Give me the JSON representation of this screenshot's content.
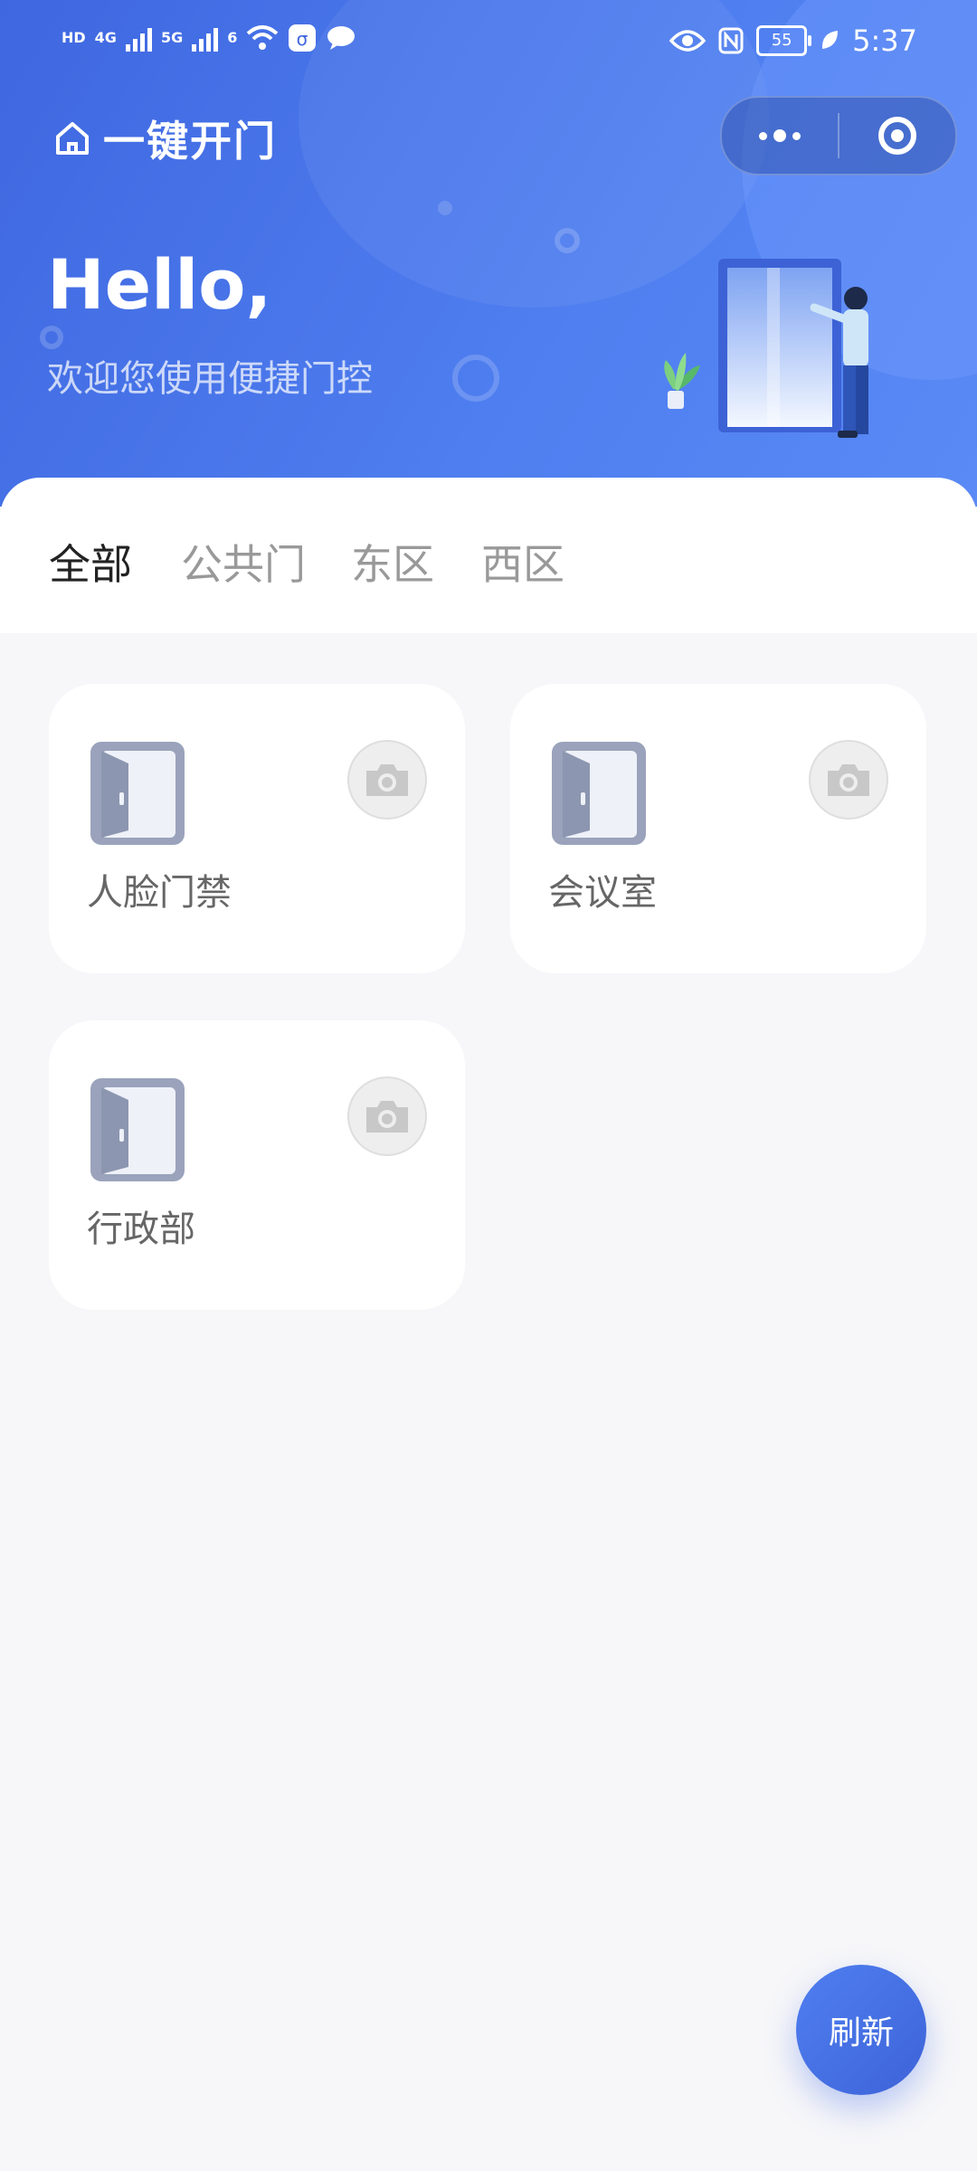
{
  "status_bar": {
    "left_labels": [
      "HD",
      "4G",
      "5G",
      "6"
    ],
    "battery": "55",
    "time": "5:37",
    "icons": [
      "hd-icon",
      "signal-icon",
      "wifi-icon",
      "alarm-icon",
      "chat-icon",
      "eye-icon",
      "nfc-icon",
      "battery-icon",
      "leaf-icon"
    ]
  },
  "header": {
    "title": "一键开门",
    "greeting": "Hello,",
    "welcome": "欢迎您使用便捷门控"
  },
  "tabs": [
    {
      "label": "全部",
      "active": true
    },
    {
      "label": "公共门",
      "active": false
    },
    {
      "label": "东区",
      "active": false
    },
    {
      "label": "西区",
      "active": false
    }
  ],
  "doors": [
    {
      "label": "人脸门禁"
    },
    {
      "label": "会议室"
    },
    {
      "label": "行政部"
    }
  ],
  "fab": {
    "label": "刷新"
  },
  "colors": {
    "brand": "#4a74ea",
    "background": "#f7f7f9",
    "tab_active": "#222222",
    "tab_inactive": "#999999"
  }
}
